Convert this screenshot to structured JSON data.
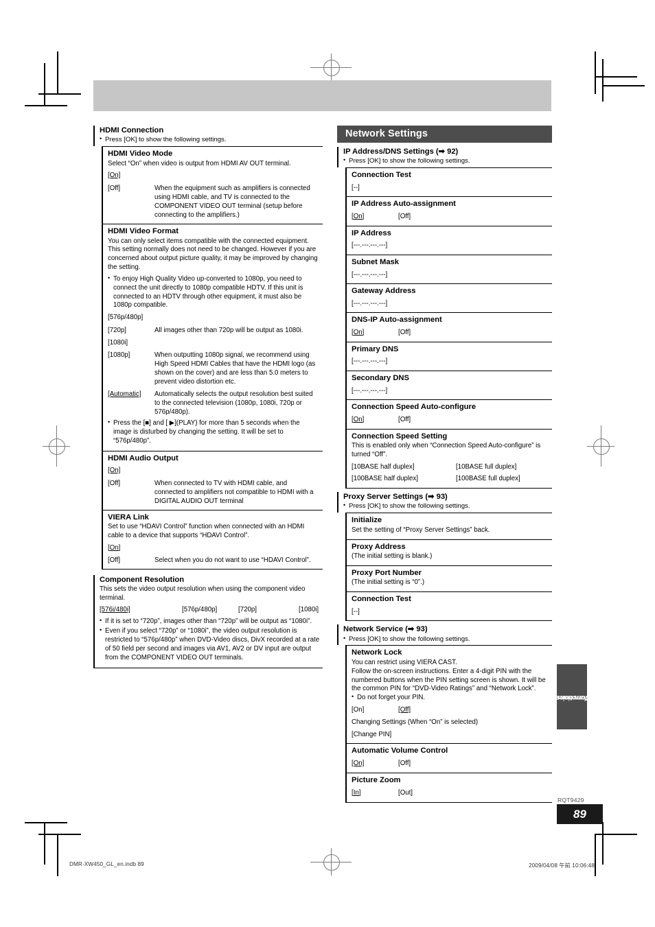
{
  "page": {
    "number": "89",
    "doc_code": "RQT9429",
    "side_tab_line1": "Convenient",
    "side_tab_line2": "functions",
    "footer_left": "DMR-XW450_GL_en.indb   89",
    "footer_right": "2009/04/08   午前 10:06:48"
  },
  "colors": {
    "header_bar": "#4d4d4d",
    "top_banner": "#c6c6c6",
    "page_number_box": "#1a1a1a",
    "rule": "#000000"
  },
  "left_column": {
    "entries": [
      {
        "title": "HDMI Connection",
        "bullet": "Press [OK] to show the following settings.",
        "subs": [
          {
            "title": "HDMI Video Mode",
            "desc": "Select “On” when video is output from HDMI AV OUT terminal.",
            "options": [
              {
                "label": "[On]",
                "underline": true
              }
            ],
            "defrows": [
              {
                "key": "[Off]",
                "desc": "When the equipment such as amplifiers is connected using HDMI cable, and TV is connected to the COMPONENT VIDEO OUT terminal (setup before connecting to the amplifiers.)"
              }
            ]
          },
          {
            "title": "HDMI Video Format",
            "desc": "You can only select items compatible with the connected equipment. This setting normally does not need to be changed. However if you are concerned about output picture quality, it may be improved by changing the setting.",
            "bullets": [
              "To enjoy High Quality Video up-converted to 1080p, you need to connect the unit directly to 1080p compatible HDTV. If this unit is connected to an HDTV through other equipment, it must also be 1080p compatible."
            ],
            "options": [
              {
                "label": "[576p/480p]",
                "underline": false
              }
            ],
            "defrows": [
              {
                "key": "[720p]",
                "desc": "All images other than 720p will be output as 1080i."
              },
              {
                "key": "[1080i]",
                "desc": ""
              },
              {
                "key": "[1080p]",
                "desc": "When outputting 1080p signal, we recommend using High Speed HDMI Cables that have the HDMI logo (as shown on the cover) and are less than 5.0 meters to prevent video distortion etc."
              },
              {
                "key": "[Automatic]",
                "key_underline": true,
                "desc": "Automatically selects the output resolution best suited to the connected television (1080p, 1080i, 720p or 576p/480p)."
              }
            ],
            "bullets_after": [
              "Press the [■] and [ ▶](PLAY) for more than 5 seconds when the image is disturbed by changing the setting. It will be set to “576p/480p”."
            ]
          },
          {
            "title": "HDMI Audio Output",
            "desc": "",
            "options": [
              {
                "label": "[On]",
                "underline": true
              }
            ],
            "defrows": [
              {
                "key": "[Off]",
                "desc": "When connected to TV with HDMI cable, and connected to amplifiers not compatible to HDMI with a DIGITAL AUDIO OUT terminal"
              }
            ]
          },
          {
            "title": "VIERA Link",
            "desc": "Set to use “HDAVI Control” function when connected with an HDMI cable to a device that supports “HDAVI Control”.",
            "options": [
              {
                "label": "[On]",
                "underline": true
              }
            ],
            "defrows": [
              {
                "key": "[Off]",
                "desc": "Select when you do not want to use “HDAVI Control”."
              }
            ]
          }
        ]
      },
      {
        "title": "Component Resolution",
        "desc": "This sets the video output resolution when using the component video terminal.",
        "options": [
          {
            "label": "[576i/480i]",
            "underline": true
          },
          {
            "label": "[576p/480p]",
            "underline": false
          },
          {
            "label": "[720p]",
            "underline": false
          },
          {
            "label": "[1080i]",
            "underline": false
          }
        ],
        "bullets": [
          "If it is set to “720p”, images other than “720p” will be output as “1080i”.",
          "Even if you select “720p” or “1080i”, the video output resolution is restricted to “576p/480p” when DVD-Video discs, DivX recorded at a rate of 50 field per second and images via AV1, AV2 or DV input are output from the COMPONENT VIDEO OUT terminals."
        ]
      }
    ]
  },
  "right_column": {
    "header": "Network Settings",
    "entries": [
      {
        "title": "IP Address/DNS Settings (➡ 92)",
        "bullet": "Press [OK] to show the following settings.",
        "subs": [
          {
            "title": "Connection Test",
            "value": "[--]"
          },
          {
            "title": "IP Address Auto-assignment",
            "options": [
              {
                "label": "[On]",
                "underline": true
              },
              {
                "label": "[Off]",
                "underline": false
              }
            ]
          },
          {
            "title": "IP Address",
            "value": "[---.---.---.---]"
          },
          {
            "title": "Subnet Mask",
            "value": "[---.---.---.---]"
          },
          {
            "title": "Gateway Address",
            "value": "[---.---.---.---]"
          },
          {
            "title": "DNS-IP Auto-assignment",
            "options": [
              {
                "label": "[On]",
                "underline": true
              },
              {
                "label": "[Off]",
                "underline": false
              }
            ]
          },
          {
            "title": "Primary DNS",
            "value": "[---.---.---.---]"
          },
          {
            "title": "Secondary DNS",
            "value": "[---.---.---.---]"
          },
          {
            "title": "Connection Speed Auto-configure",
            "options": [
              {
                "label": "[On]",
                "underline": true
              },
              {
                "label": "[Off]",
                "underline": false
              }
            ]
          },
          {
            "title": "Connection Speed Setting",
            "desc": "This is enabled only when “Connection Speed Auto-configure” is turned “Off”.",
            "options_grid": [
              [
                "[10BASE half duplex]",
                "[10BASE full duplex]"
              ],
              [
                "[100BASE half duplex]",
                "[100BASE full duplex]"
              ]
            ]
          }
        ]
      },
      {
        "title": "Proxy Server Settings (➡ 93)",
        "bullet": "Press [OK] to show the following settings.",
        "subs": [
          {
            "title": "Initialize",
            "desc": "Set the setting of “Proxy Server Settings” back."
          },
          {
            "title": "Proxy Address",
            "desc": "(The initial setting is blank.)"
          },
          {
            "title": "Proxy Port Number",
            "desc": "(The initial setting is “0”.)"
          },
          {
            "title": "Connection Test",
            "value": "[--]"
          }
        ]
      },
      {
        "title": "Network Service (➡ 93)",
        "bullet": "Press [OK] to show the following settings.",
        "subs": [
          {
            "title": "Network Lock",
            "desc": "You can restrict using VIERA CAST.\nFollow the on-screen instructions. Enter a 4-digit PIN with the numbered buttons when the PIN setting screen is shown. It will be the common PIN for “DVD-Video Ratings” and “Network Lock”.",
            "bullets": [
              "Do not forget your PIN."
            ],
            "options": [
              {
                "label": "[On]",
                "underline": false
              },
              {
                "label": "[Off]",
                "underline": true
              }
            ],
            "note": "Changing Settings (When “On” is selected)",
            "value": "[Change PIN]"
          },
          {
            "title": "Automatic Volume Control",
            "options": [
              {
                "label": "[On]",
                "underline": true
              },
              {
                "label": "[Off]",
                "underline": false
              }
            ]
          },
          {
            "title": "Picture Zoom",
            "options": [
              {
                "label": "[In]",
                "underline": true
              },
              {
                "label": "[Out]",
                "underline": false
              }
            ]
          }
        ]
      }
    ]
  }
}
